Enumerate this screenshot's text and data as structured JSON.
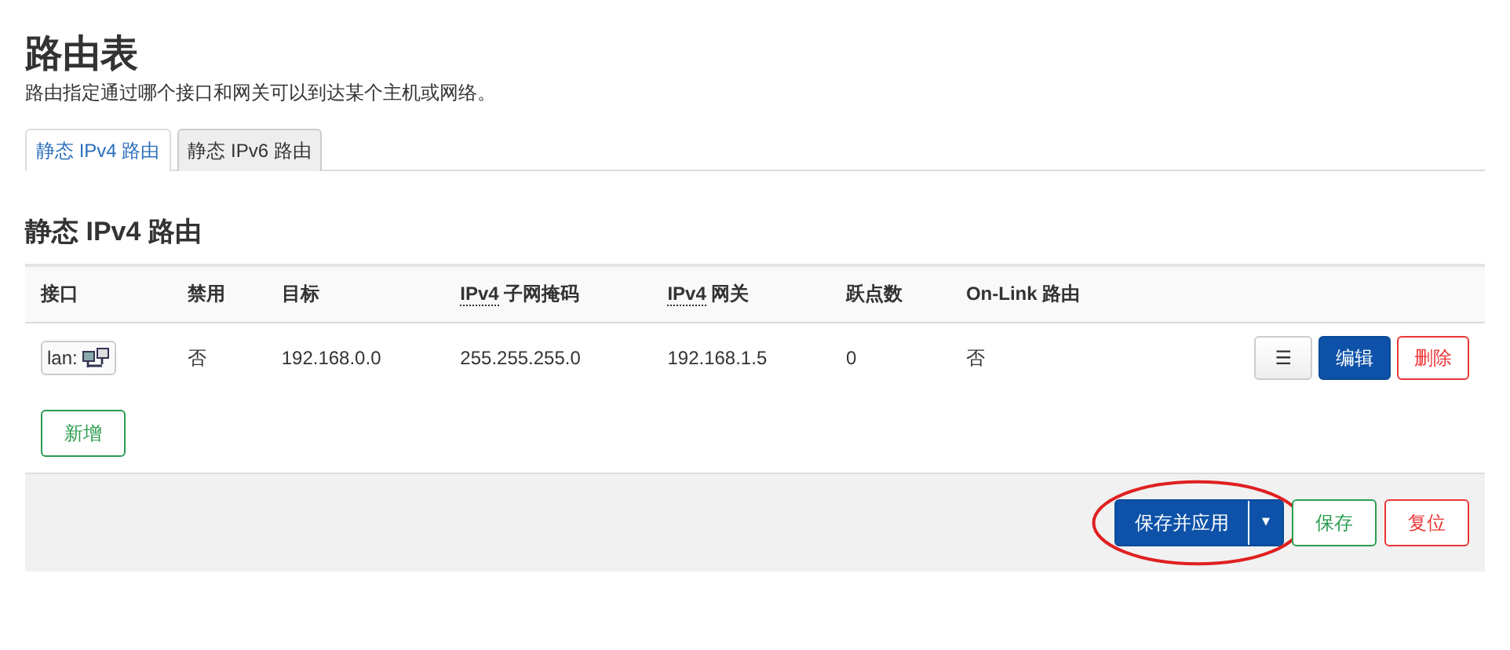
{
  "title": "路由表",
  "description": "路由指定通过哪个接口和网关可以到达某个主机或网络。",
  "tabs": [
    {
      "label": "静态 IPv4 路由",
      "selected": true
    },
    {
      "label": "静态 IPv6 路由",
      "selected": false
    }
  ],
  "section_title": "静态 IPv4 路由",
  "table": {
    "columns": [
      {
        "label": "接口"
      },
      {
        "label": "禁用"
      },
      {
        "label": "目标"
      },
      {
        "abbr": "IPv4",
        "label": " 子网掩码"
      },
      {
        "abbr": "IPv4",
        "label": " 网关"
      },
      {
        "label": "跃点数"
      },
      {
        "label": "On-Link 路由"
      }
    ],
    "rows": [
      {
        "cells": [
          "lan:",
          "否",
          "192.168.0.0",
          "255.255.255.0",
          "192.168.1.5",
          "0",
          "否"
        ],
        "actions": [
          {
            "kind": "menu",
            "label": "☰"
          },
          {
            "kind": "edit",
            "label": "编辑"
          },
          {
            "kind": "delete",
            "label": "删除"
          }
        ]
      }
    ]
  },
  "add_button": "新增",
  "footer_buttons": [
    {
      "kind": "apply",
      "label": "保存并应用",
      "caret": "▾",
      "circled": true
    },
    {
      "kind": "save",
      "label": "保存",
      "circled": false
    },
    {
      "kind": "reset",
      "label": "复位",
      "circled": false
    }
  ]
}
